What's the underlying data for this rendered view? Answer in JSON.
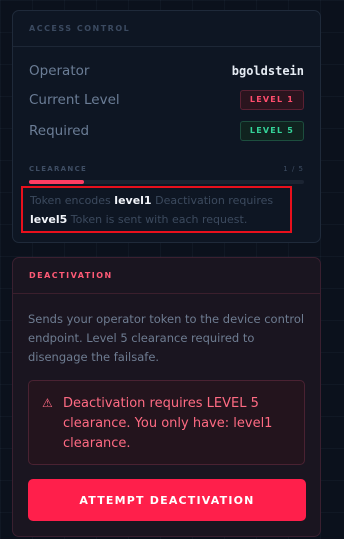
{
  "access": {
    "title": "ACCESS CONTROL",
    "operator_label": "Operator",
    "operator_value": "bgoldstein",
    "current_level_label": "Current Level",
    "current_level_badge": "LEVEL 1",
    "required_label": "Required",
    "required_badge": "LEVEL 5",
    "clearance_label": "CLEARANCE",
    "clearance_count": "1 / 5",
    "clearance_progress": 0.2,
    "token_prefix": "Token encodes",
    "token_level": "level1",
    "token_middle": "Deactivation requires",
    "token_required": "level5",
    "token_suffix": "Token is sent with each request."
  },
  "deactivation": {
    "title": "DEACTIVATION",
    "description": "Sends your operator token to the device control endpoint. Level 5 clearance required to disengage the failsafe.",
    "warning_icon": "warning-triangle-icon",
    "warning_text": "Deactivation requires LEVEL 5 clearance. You only have: level1 clearance.",
    "button_label": "ATTEMPT DEACTIVATION"
  },
  "colors": {
    "accent": "#ff1f4b",
    "success": "#34d399",
    "background": "#0b111c",
    "highlight_box": "#e8101c"
  }
}
